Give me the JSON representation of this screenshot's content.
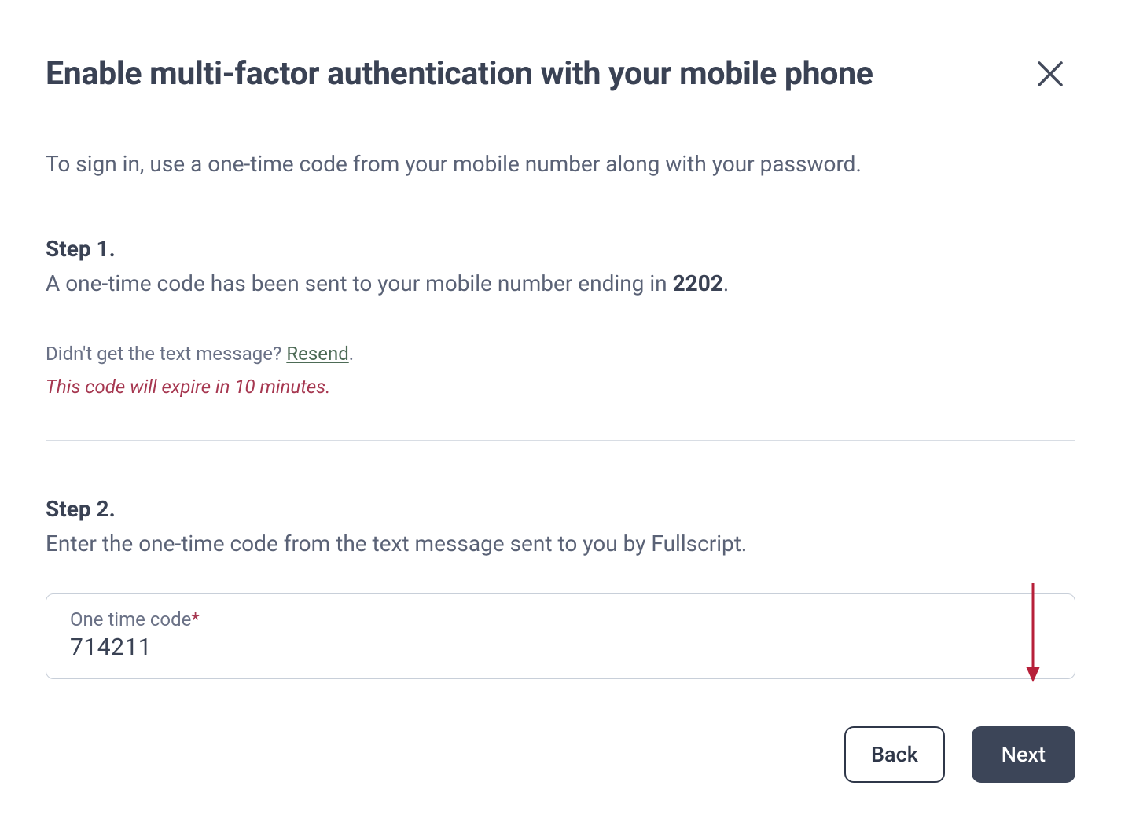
{
  "header": {
    "title": "Enable multi-factor authentication with your mobile phone"
  },
  "subtitle": "To sign in, use a one-time code from your mobile number along with your password.",
  "step1": {
    "heading": "Step 1.",
    "detail_pre": "A one-time code has been sent to your mobile number ending in ",
    "detail_bold": "2202",
    "detail_post": ".",
    "resend_pre": "Didn't get the text message? ",
    "resend_link": "Resend",
    "resend_post": ".",
    "expire_note": "This code will expire in 10 minutes."
  },
  "step2": {
    "heading": "Step 2.",
    "detail": "Enter the one-time code from the text message sent to you by Fullscript.",
    "input_label": "One time code",
    "input_value": "714211"
  },
  "footer": {
    "back_label": "Back",
    "next_label": "Next"
  }
}
